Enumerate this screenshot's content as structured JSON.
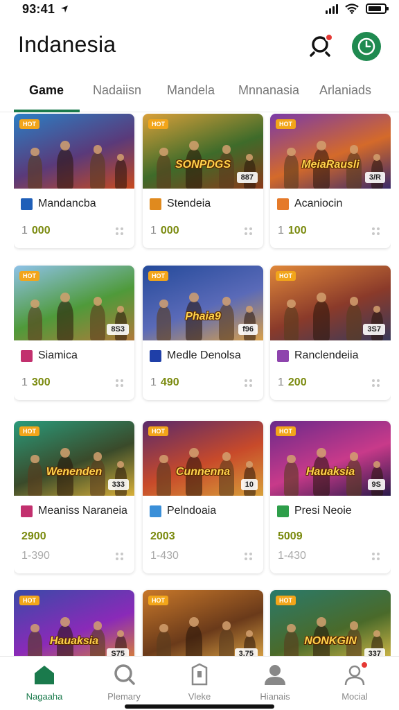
{
  "status": {
    "time": "93:41"
  },
  "header": {
    "title": "Indanesia"
  },
  "tabs": [
    "Game",
    "Nadaiisn",
    "Mandela",
    "Mnnanasia",
    "Arlaniads"
  ],
  "cards": [
    {
      "tag": "HOT",
      "thumb_title": "",
      "thumb_num": "",
      "name": "Mandancba",
      "icon": "flag-icon",
      "icon_color": "#1f5fb8",
      "prefix": "1",
      "value": "000"
    },
    {
      "tag": "HOT",
      "thumb_title": "SONPDGS",
      "thumb_num": "887",
      "name": "Stendeia",
      "icon": "card-icon",
      "icon_color": "#e08a1e",
      "prefix": "1",
      "value": "000"
    },
    {
      "tag": "HOT",
      "thumb_title": "MeiaRausli",
      "thumb_num": "3/R",
      "name": "Acaniocin",
      "icon": "box-icon",
      "icon_color": "#e57a2a",
      "prefix": "1",
      "value": "100"
    },
    {
      "tag": "HOT",
      "thumb_title": "",
      "thumb_num": "8S3",
      "name": "Siamica",
      "icon": "star-icon",
      "icon_color": "#c2306e",
      "prefix": "1",
      "value": "300"
    },
    {
      "tag": "HOT",
      "thumb_title": "Phaia9",
      "thumb_num": "f96",
      "name": "Medle Denolsa",
      "icon": "bars-icon",
      "icon_color": "#1f3fa8",
      "prefix": "1",
      "value": "490"
    },
    {
      "tag": "HOT",
      "thumb_title": "",
      "thumb_num": "3S7",
      "name": "Ranclendeiia",
      "icon": "gem-icon",
      "icon_color": "#8e44ad",
      "prefix": "1",
      "value": "200"
    },
    {
      "tag": "HOT",
      "thumb_title": "Wenenden",
      "thumb_num": "333",
      "name": "Meaniss Naraneia",
      "icon": "square-icon",
      "icon_color": "#c2306e",
      "big": "2900",
      "sub": "1-390"
    },
    {
      "tag": "HOT",
      "thumb_title": "Cunnenna",
      "thumb_num": "10",
      "name": "Pelndoaia",
      "icon": "puzzle-icon",
      "icon_color": "#3a8fd8",
      "big": "2003",
      "sub": "1-430"
    },
    {
      "tag": "HOT",
      "thumb_title": "Hauaksia",
      "thumb_num": "9S",
      "name": "Presi Neoie",
      "icon": "leaf-icon",
      "icon_color": "#2e9e4a",
      "big": "5009",
      "sub": "1-430"
    },
    {
      "tag": "HOT",
      "thumb_title": "Hauaksia",
      "thumb_num": "S75",
      "name": ""
    },
    {
      "tag": "HOT",
      "thumb_title": "",
      "thumb_num": "3.75",
      "name": ""
    },
    {
      "tag": "HOT",
      "thumb_title": "NONKGIN",
      "thumb_num": "337",
      "name": ""
    }
  ],
  "nav": [
    {
      "label": "Nagaaha",
      "icon": "home-icon"
    },
    {
      "label": "Plemary",
      "icon": "search-icon"
    },
    {
      "label": "Vleke",
      "icon": "shield-icon"
    },
    {
      "label": "Hianais",
      "icon": "person-icon"
    },
    {
      "label": "Mocial",
      "icon": "profile-icon"
    }
  ],
  "colors": {
    "accent": "#1a7a4c",
    "value": "#7a8a0e",
    "badge": "#e53935",
    "tag": "#f2a51a"
  }
}
